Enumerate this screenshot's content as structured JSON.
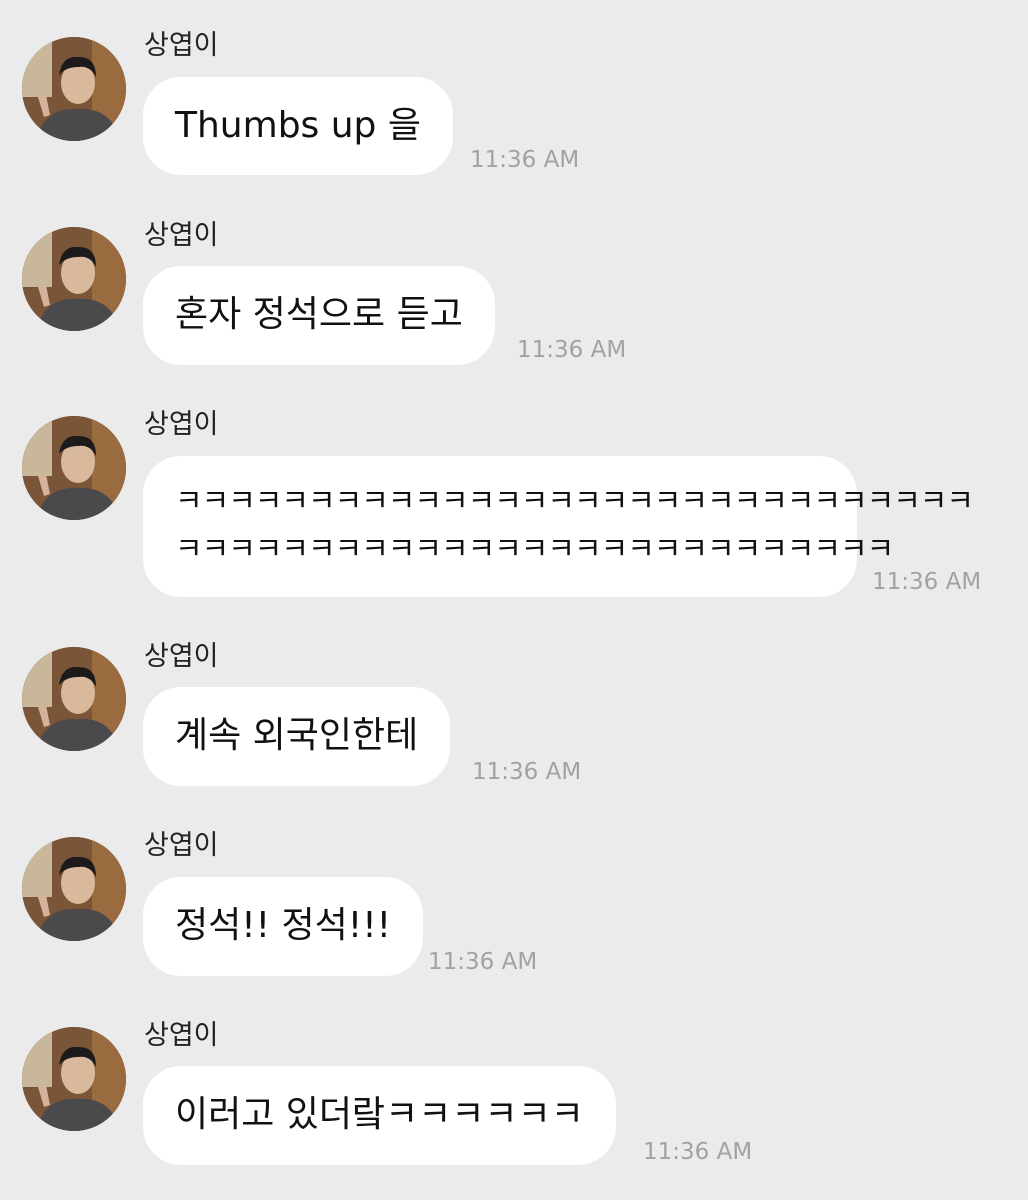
{
  "messages": [
    {
      "sender": "상엽이",
      "lines": [
        "Thumbs up 을"
      ],
      "time": "11:36 AM"
    },
    {
      "sender": "상엽이",
      "lines": [
        "혼자 정석으로 듣고"
      ],
      "time": "11:36 AM"
    },
    {
      "sender": "상엽이",
      "lines": [
        "ㅋㅋㅋㅋㅋㅋㅋㅋㅋㅋㅋㅋㅋㅋㅋㅋㅋㅋㅋㅋㅋㅋㅋㅋㅋㅋㅋㅋㅋㅋ",
        "ㅋㅋㅋㅋㅋㅋㅋㅋㅋㅋㅋㅋㅋㅋㅋㅋㅋㅋㅋㅋㅋㅋㅋㅋㅋㅋㅋ"
      ],
      "time": "11:36 AM"
    },
    {
      "sender": "상엽이",
      "lines": [
        "계속 외국인한테"
      ],
      "time": "11:36 AM"
    },
    {
      "sender": "상엽이",
      "lines": [
        "정석!! 정석!!!"
      ],
      "time": "11:36 AM"
    },
    {
      "sender": "상엽이",
      "lines": [
        "이러고 있더랔ㅋㅋㅋㅋㅋㅋ"
      ],
      "time": "11:36 AM"
    }
  ]
}
